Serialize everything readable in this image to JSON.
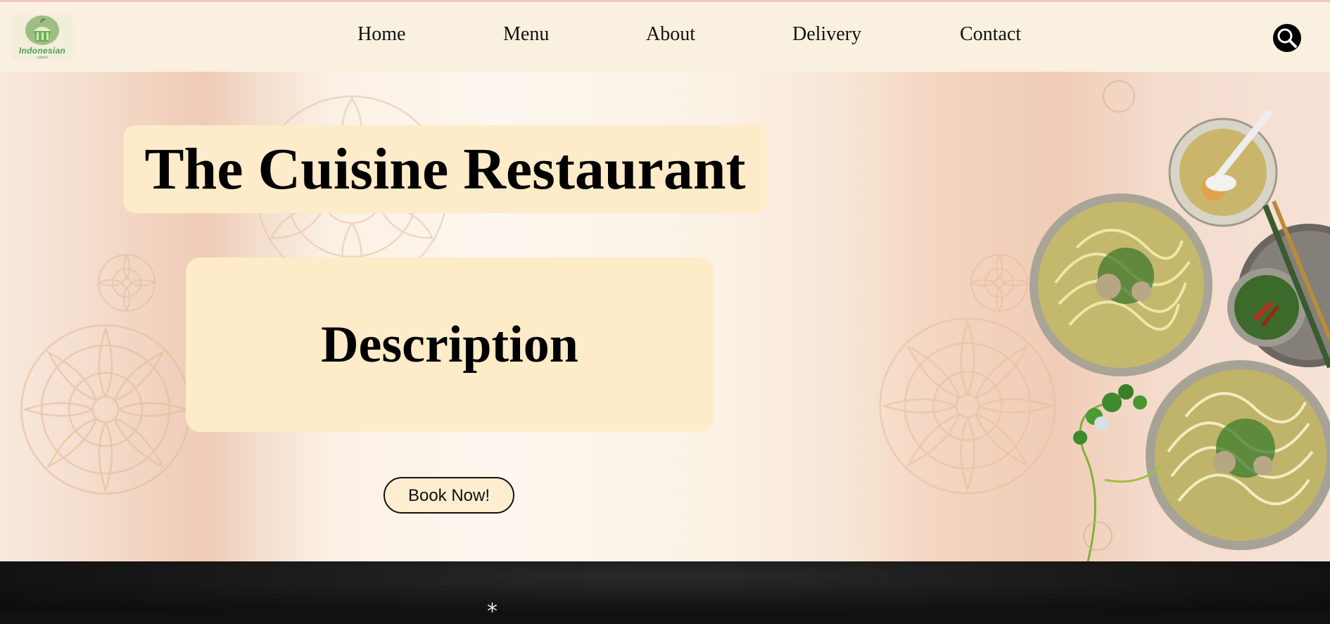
{
  "brand": {
    "logo_text": "Indonesian",
    "logo_subtext": "cuisine"
  },
  "nav": {
    "items": [
      "Home",
      "Menu",
      "About",
      "Delivery",
      "Contact"
    ],
    "search_icon": "search-icon"
  },
  "hero": {
    "title": "The Cuisine Restaurant",
    "description": "Description",
    "cta_label": "Book Now!"
  },
  "footer": {
    "glyph": "*"
  },
  "colors": {
    "nav_bg": "#faf0df",
    "panel_bg": "#feebc8",
    "accent_green": "#4e9a5d",
    "dark_band": "#151515"
  }
}
